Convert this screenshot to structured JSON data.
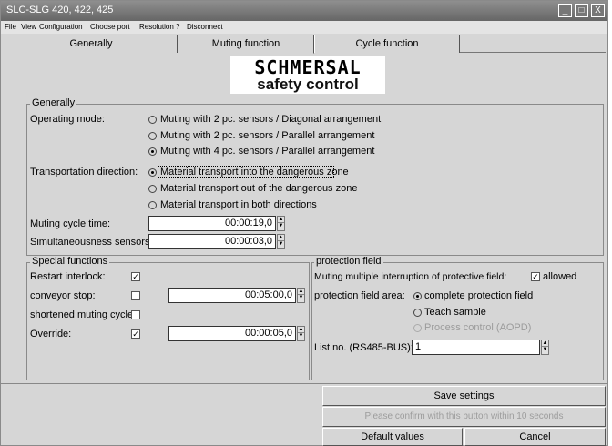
{
  "window": {
    "title": "SLC-SLG 420, 422, 425",
    "min_btn": "_",
    "max_btn": "□",
    "close_btn": "X"
  },
  "menu": [
    "File",
    "View",
    "Configuration",
    "Choose port",
    "Resolution",
    "?",
    "Disconnect"
  ],
  "tabs": [
    "Generally",
    "Muting function",
    "Cycle function"
  ],
  "active_tab": "Muting function",
  "logo": {
    "brand": "SCHMERSAL",
    "sub": "safety control"
  },
  "generally": {
    "legend": "Generally",
    "operating_mode_label": "Operating mode:",
    "operating_modes": [
      "Muting with 2 pc. sensors / Diagonal arrangement",
      "Muting with 2 pc. sensors / Parallel arrangement",
      "Muting with 4 pc. sensors / Parallel arrangement"
    ],
    "operating_mode_selected": 2,
    "transport_label": "Transportation direction:",
    "transport_options": [
      "Material transport into the dangerous zone",
      "Material transport out of the dangerous zone",
      "Material transport in both directions"
    ],
    "transport_selected": 0,
    "cycle_time_label": "Muting cycle time:",
    "cycle_time_value": "00:00:19,0",
    "simul_label": "Simultaneousness sensors:",
    "simul_value": "00:00:03,0"
  },
  "special": {
    "legend": "Special functions",
    "restart_label": "Restart interlock:",
    "restart_checked": true,
    "conveyor_label": "conveyor stop:",
    "conveyor_checked": false,
    "conveyor_value": "00:05:00,0",
    "shortened_label": "shortened muting cycle:",
    "shortened_checked": false,
    "override_label": "Override:",
    "override_checked": true,
    "override_value": "00:00:05,0"
  },
  "protection": {
    "legend": "protection field",
    "multi_label": "Muting multiple interruption of protective field:",
    "allowed_label": "allowed",
    "allowed_checked": true,
    "area_label": "protection field area:",
    "area_options": [
      "complete protection field",
      "Teach sample",
      "Process control (AOPD)"
    ],
    "area_selected": 0,
    "listno_label": "List no. (RS485-BUS):",
    "listno_value": "1"
  },
  "buttons": {
    "save": "Save settings",
    "confirm": "Please confirm with this button within 10 seconds",
    "default": "Default values",
    "cancel": "Cancel"
  },
  "colors": {
    "titlebar": "#777777",
    "background": "#d6d6d6",
    "disabled_text": "#9c9c9c"
  }
}
